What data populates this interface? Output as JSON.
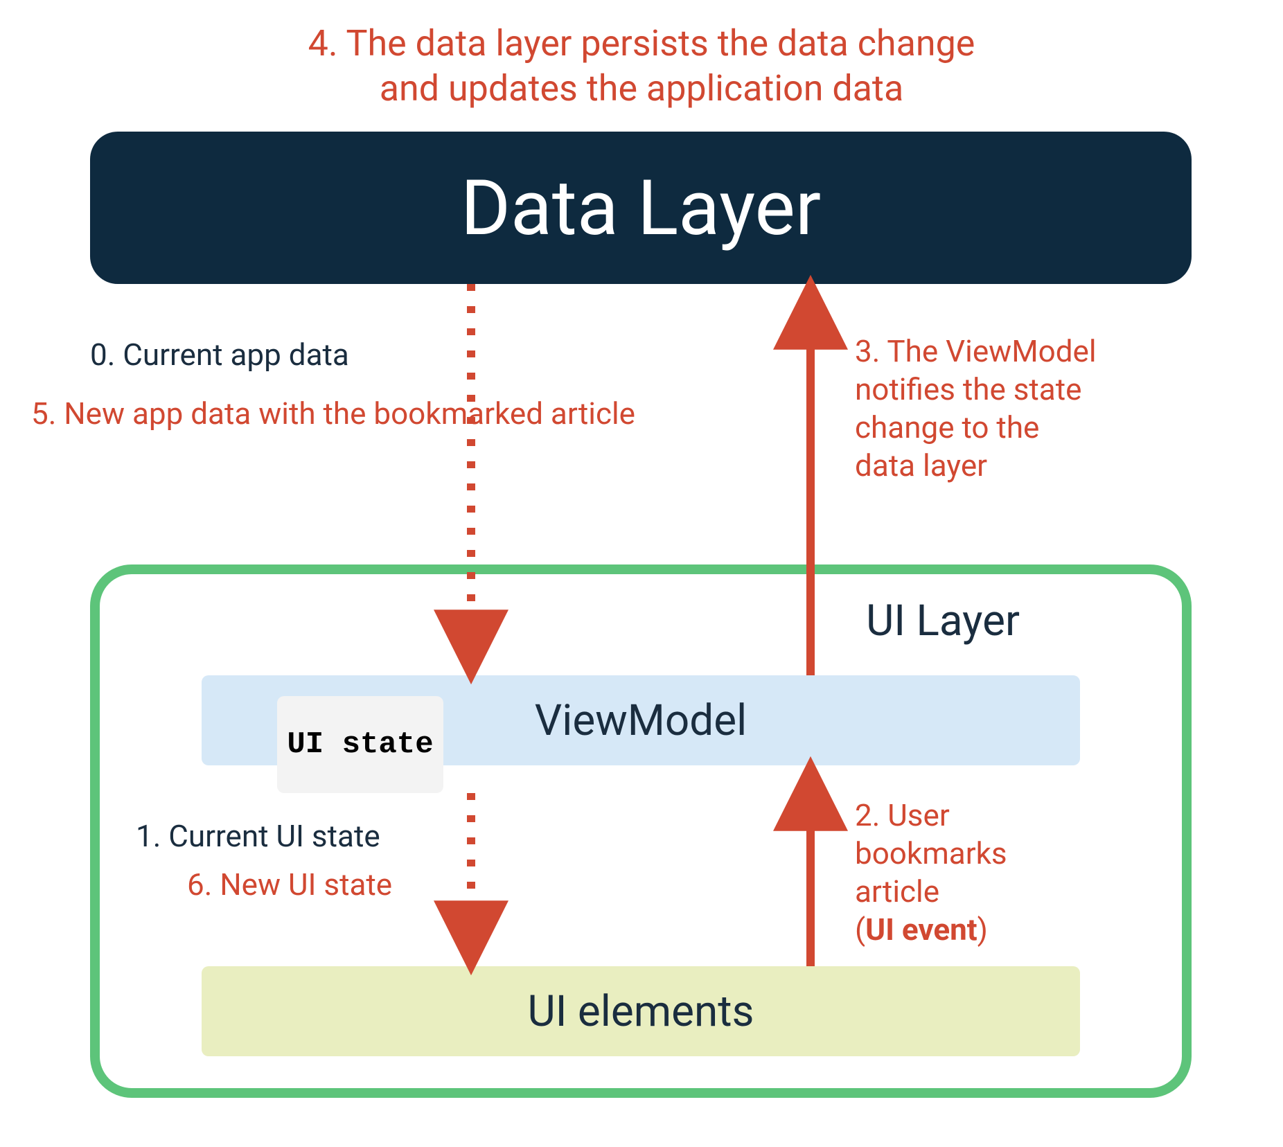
{
  "top_caption_line1": "4. The data layer persists the data change",
  "top_caption_line2": "and updates the application data",
  "data_layer_label": "Data Layer",
  "ui_layer_label": "UI Layer",
  "viewmodel_label": "ViewModel",
  "ui_state_label": "UI state",
  "ui_elements_label": "UI elements",
  "annot0": "0. Current app data",
  "annot5": "5. New app data with the bookmarked article",
  "annot3_l1": "3. The ViewModel",
  "annot3_l2": "notifies the state",
  "annot3_l3": "change to the",
  "annot3_l4": "data layer",
  "annot1": "1. Current UI state",
  "annot6": "6. New UI state",
  "annot2_l1": "2. User",
  "annot2_l2": "bookmarks",
  "annot2_l3": "article",
  "annot2_l4a": "(",
  "annot2_l4b": "UI event",
  "annot2_l4c": ")"
}
